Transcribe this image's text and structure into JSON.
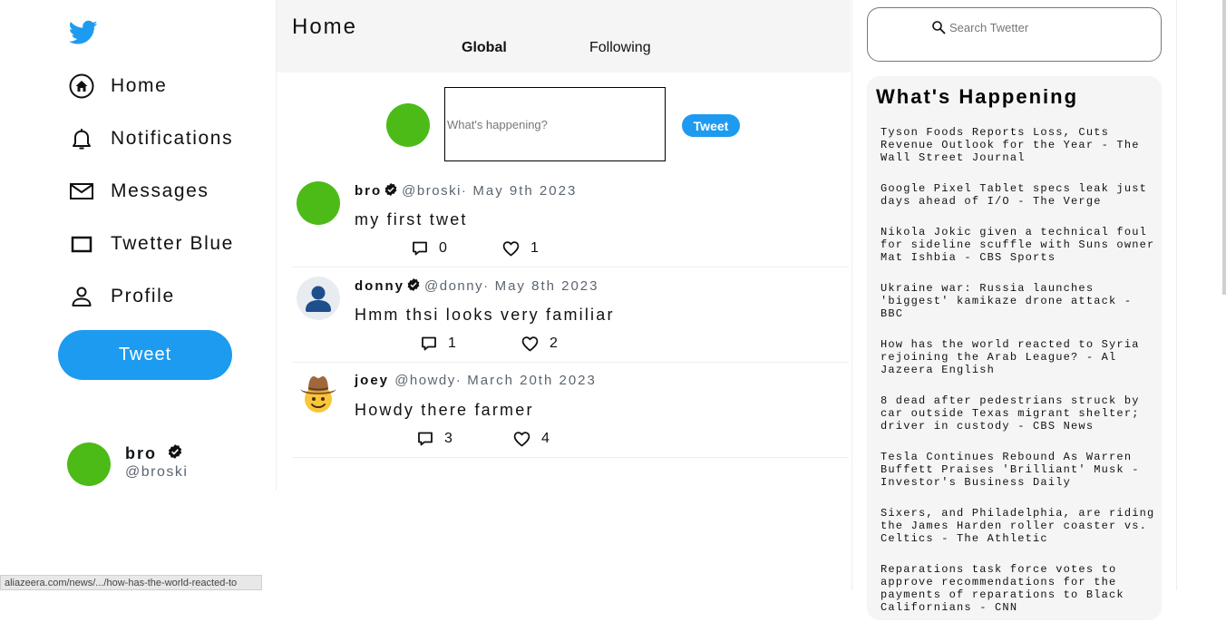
{
  "colors": {
    "accent": "#1d9bf0",
    "avatar_green": "#4cbb17",
    "panel": "#f5f5f5"
  },
  "sidebar": {
    "logo_icon": "bird-icon",
    "nav": [
      {
        "label": "Home",
        "icon": "home-icon"
      },
      {
        "label": "Notifications",
        "icon": "bell-icon"
      },
      {
        "label": "Messages",
        "icon": "mail-icon"
      },
      {
        "label": "Twetter Blue",
        "icon": "square-icon"
      },
      {
        "label": "Profile",
        "icon": "person-icon"
      }
    ],
    "tweet_label": "Tweet",
    "profile": {
      "name": "bro",
      "handle": "@broski"
    }
  },
  "header": {
    "title": "Home",
    "tabs": [
      {
        "label": "Global"
      },
      {
        "label": "Following"
      }
    ]
  },
  "composer": {
    "placeholder": "What's happening?",
    "button": "Tweet"
  },
  "feed": [
    {
      "name": "bro",
      "handle": "@broski·",
      "date": "May 9th 2023",
      "text": "my first twet",
      "comments": "0",
      "likes": "1",
      "avatar": "green"
    },
    {
      "name": "donny",
      "handle": "@donny·",
      "date": "May 8th 2023",
      "text": "Hmm thsi looks very familiar",
      "comments": "1",
      "likes": "2",
      "avatar": "default-person"
    },
    {
      "name": "joey",
      "handle": "@howdy·",
      "date": "March 20th 2023",
      "text": "Howdy there farmer",
      "comments": "3",
      "likes": "4",
      "avatar": "cowboy-emoji"
    }
  ],
  "search": {
    "placeholder": "Search Twetter"
  },
  "happening": {
    "title": "What's Happening",
    "items": [
      "Tyson Foods Reports Loss, Cuts Revenue Outlook for the Year - The Wall Street Journal",
      "Google Pixel Tablet specs leak just days ahead of I/O - The Verge",
      "Nikola Jokic given a technical foul for sideline scuffle with Suns owner Mat Ishbia - CBS Sports",
      "Ukraine war: Russia launches 'biggest' kamikaze drone attack - BBC",
      "How has the world reacted to Syria rejoining the Arab League? - Al Jazeera English",
      "8 dead after pedestrians struck by car outside Texas migrant shelter; driver in custody - CBS News",
      "Tesla Continues Rebound As Warren Buffett Praises 'Brilliant' Musk - Investor's Business Daily",
      "Sixers, and Philadelphia, are riding the James Harden roller coaster vs. Celtics - The Athletic",
      "Reparations task force votes to approve recommendations for the payments of reparations to Black Californians - CNN"
    ]
  },
  "status_bar": {
    "url": "aliazeera.com/news/.../how-has-the-world-reacted-to"
  }
}
